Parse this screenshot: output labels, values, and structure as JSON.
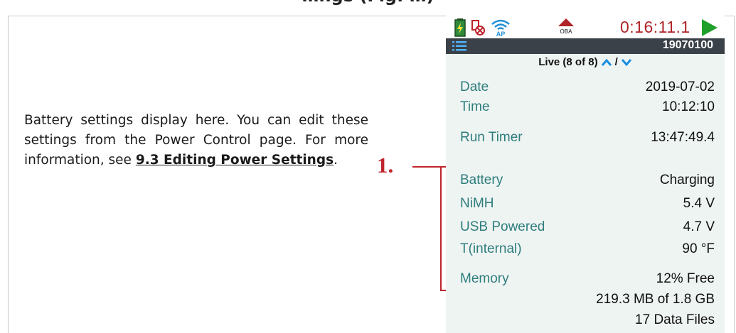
{
  "heading": "…ngs (Fig. …)",
  "description": {
    "text": "Battery settings display here. You can edit these settings from the Power Control page. For more information, see ",
    "link": "9.3 Editing Power Settings",
    "trailing": "."
  },
  "callout": {
    "number": "1."
  },
  "device": {
    "status": {
      "icons": [
        "battery-charging-icon",
        "usb-disconnected-icon",
        "wifi-ap-icon"
      ],
      "ap_label": "AP",
      "oba_label": "OBA",
      "clock": "0:16:11.1",
      "run_state": "play-icon"
    },
    "titlebar": {
      "serial": "19070100"
    },
    "pager": {
      "label": "Live (8 of 8)",
      "separator": "/"
    },
    "rows": [
      {
        "key": "Date",
        "value": "2019-07-02"
      },
      {
        "key": "Time",
        "value": "10:12:10"
      },
      {
        "key": "Run Timer",
        "value": "13:47:49.4"
      },
      {
        "key": "Battery",
        "value": "Charging"
      },
      {
        "key": "NiMH",
        "value": "5.4 V"
      },
      {
        "key": "USB Powered",
        "value": "4.7 V"
      },
      {
        "key": "T(internal)",
        "value": "90 °F"
      },
      {
        "key": "Memory",
        "value": "12% Free"
      },
      {
        "key": "",
        "value": "219.3 MB of 1.8 GB"
      },
      {
        "key": "",
        "value": "17 Data Files"
      }
    ],
    "colors": {
      "label": "#2e7d7d",
      "clock": "#b02327",
      "play": "#1ea02a",
      "titlebar": "#3b4148",
      "callout": "#c0242c"
    }
  }
}
